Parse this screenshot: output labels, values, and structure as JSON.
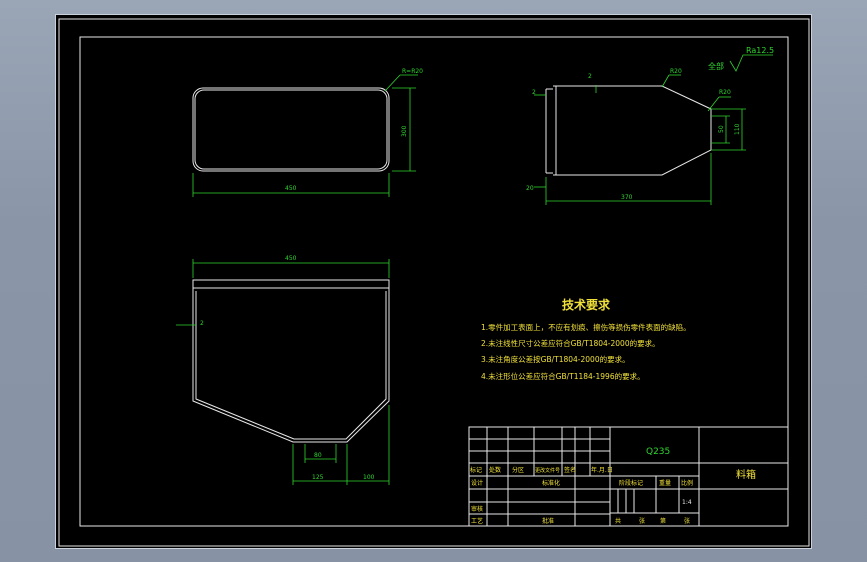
{
  "dims": {
    "front_width": "450",
    "front_height": "300",
    "corner_radius": "R=R20",
    "side_width": "370",
    "side_height": "110",
    "side_inner_height": "50",
    "side_chamfer": "R20",
    "side_chamfer2": "R20",
    "side_thickness": "2",
    "side_thickness2": "20",
    "side_mark": "2",
    "bottom_width": "450",
    "bottom_thickness": "2",
    "bottom_outlet_inner": "80",
    "bottom_outlet_outer": "125",
    "bottom_side": "100"
  },
  "roughness": {
    "label": "全部",
    "value": "Ra12.5"
  },
  "tech_req": {
    "title": "技术要求",
    "items": [
      "1.零件加工表面上，不应有划痕、擦伤等损伤零件表面的缺陷。",
      "2.未注线性尺寸公差应符合GB/T1804-2000的要求。",
      "3.未注角度公差按GB/T1804-2000的要求。",
      "4.未注形位公差应符合GB/T1184-1996的要求。"
    ]
  },
  "title_block": {
    "material": "Q235",
    "part_name": "料箱",
    "scale": "1:4",
    "hdr_mark": "标记",
    "hdr_count": "处数",
    "hdr_zone": "分区",
    "hdr_change": "更改文件号",
    "hdr_sign": "签名",
    "hdr_date": "年.月.日",
    "design": "设计",
    "standard": "标准化",
    "stage_mark": "阶段标记",
    "weight": "重量",
    "ratio": "比例",
    "audit": "审核",
    "process": "工艺",
    "approve": "批准",
    "sheet_total": "共",
    "sheet_total_unit": "张",
    "sheet_no": "第",
    "sheet_no_unit": "张"
  }
}
